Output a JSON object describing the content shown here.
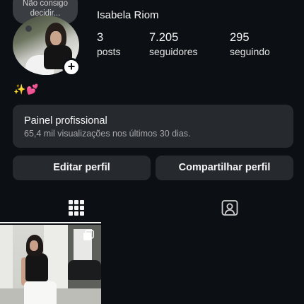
{
  "profile": {
    "note": "Não consigo decidir...",
    "name": "Isabela Riom",
    "emojis": "✨💕",
    "stats": [
      {
        "value": "3",
        "label": "posts"
      },
      {
        "value": "7.205",
        "label": "seguidores"
      },
      {
        "value": "295",
        "label": "seguindo"
      }
    ]
  },
  "panel": {
    "title": "Painel profissional",
    "subtitle": "65,4 mil visualizações nos últimos 30 dias."
  },
  "buttons": {
    "edit": "Editar perfil",
    "share": "Compartilhar perfil"
  },
  "tabs": [
    {
      "icon": "grid-icon",
      "selected": true
    },
    {
      "icon": "tagged-icon",
      "selected": false
    }
  ],
  "colors": {
    "background": "#0c1014",
    "card": "#262a2f",
    "text": "#f5f5f5",
    "muted": "#a8a8a8"
  }
}
